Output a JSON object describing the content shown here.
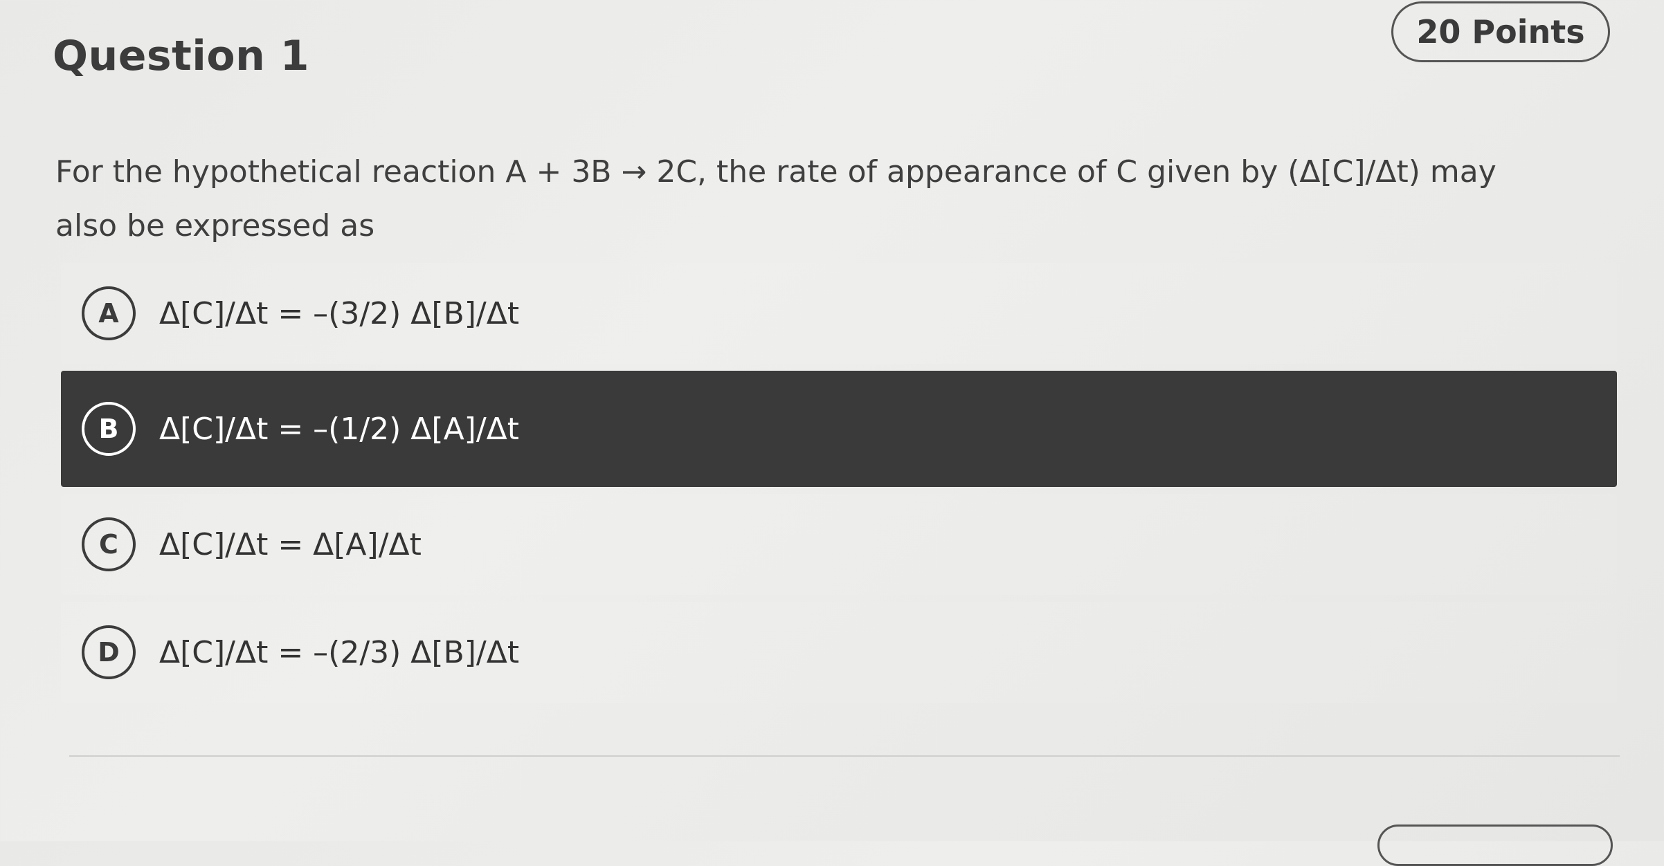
{
  "question": {
    "title": "Question 1",
    "points": "20 Points",
    "prompt": "For the hypothetical reaction A + 3B → 2C, the rate of appearance of C given by (Δ[C]/Δt) may also be expressed as"
  },
  "options": [
    {
      "letter": "A",
      "text": "Δ[C]/Δt = –(3/2) Δ[B]/Δt",
      "selected": false
    },
    {
      "letter": "B",
      "text": "Δ[C]/Δt = –(1/2) Δ[A]/Δt",
      "selected": true
    },
    {
      "letter": "C",
      "text": "Δ[C]/Δt = Δ[A]/Δt",
      "selected": false
    },
    {
      "letter": "D",
      "text": "Δ[C]/Δt = –(2/3) Δ[B]/Δt",
      "selected": false
    }
  ],
  "colors": {
    "selected_background": "#3a3a3a",
    "selected_text": "#ffffff",
    "text": "#333333"
  }
}
